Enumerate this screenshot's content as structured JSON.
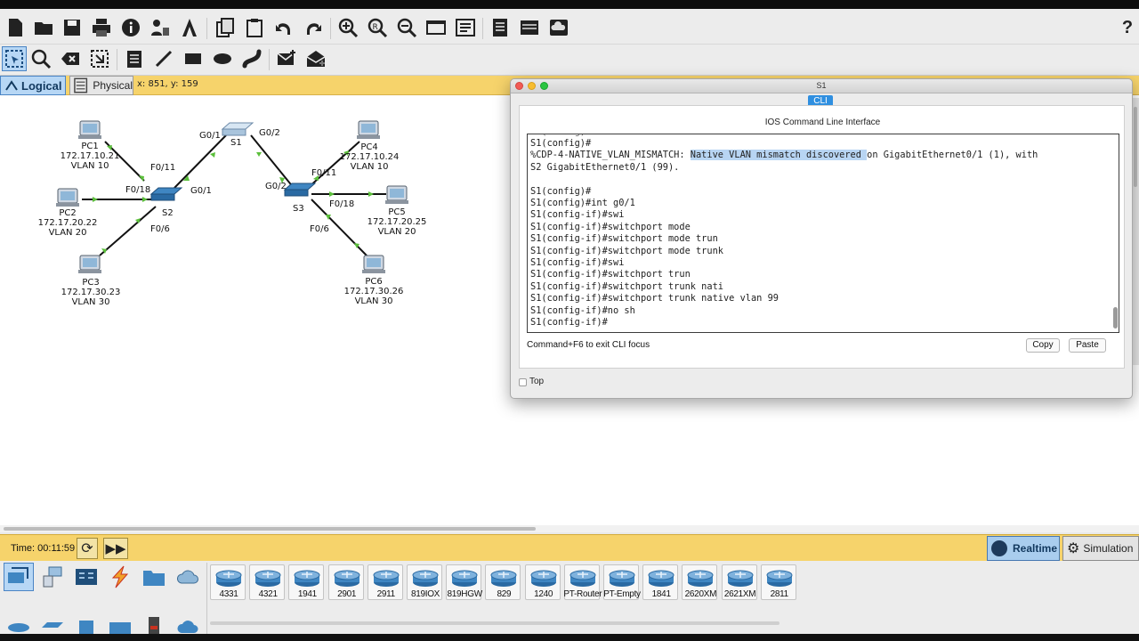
{
  "toolbar": {
    "help_label": "?"
  },
  "mode": {
    "logical_label": "Logical",
    "physical_label": "Physical",
    "coords": "x: 851, y: 159"
  },
  "topology": {
    "devices": {
      "pc1": {
        "name": "PC1",
        "ip": "172.17.10.21",
        "vlan": "VLAN 10"
      },
      "pc2": {
        "name": "PC2",
        "ip": "172.17.20.22",
        "vlan": "VLAN 20"
      },
      "pc3": {
        "name": "PC3",
        "ip": "172.17.30.23",
        "vlan": "VLAN 30"
      },
      "pc4": {
        "name": "PC4",
        "ip": "172.17.10.24",
        "vlan": "VLAN 10"
      },
      "pc5": {
        "name": "PC5",
        "ip": "172.17.20.25",
        "vlan": "VLAN 20"
      },
      "pc6": {
        "name": "PC6",
        "ip": "172.17.30.26",
        "vlan": "VLAN 30"
      },
      "s1": {
        "name": "S1"
      },
      "s2": {
        "name": "S2"
      },
      "s3": {
        "name": "S3"
      }
    },
    "ports": {
      "s2_f011": "F0/11",
      "s2_f018": "F0/18",
      "s2_g01": "G0/1",
      "s2_f06": "F0/6",
      "s1_g01": "G0/1",
      "s1_g02": "G0/2",
      "s3_g02": "G0/2",
      "s3_f011": "F0/11",
      "s3_f018": "F0/18",
      "s3_f06": "F0/6"
    }
  },
  "cli_window": {
    "title": "S1",
    "tab": "CLI",
    "heading": "IOS Command Line Interface",
    "lines": [
      {
        "pre": "S1(config)#",
        "hl": "",
        "post": ""
      },
      {
        "pre": "%CDP-4-NATIVE_VLAN_MISMATCH: ",
        "hl": "Native VLAN mismatch discovered ",
        "post": "on GigabitEthernet0/1 (1), with"
      },
      {
        "pre": "S2 GigabitEthernet0/1 (99).",
        "hl": "",
        "post": ""
      },
      {
        "pre": "",
        "hl": "",
        "post": ""
      },
      {
        "pre": "S1(config)#",
        "hl": "",
        "post": ""
      },
      {
        "pre": "S1(config)#int g0/1",
        "hl": "",
        "post": ""
      },
      {
        "pre": "S1(config-if)#swi",
        "hl": "",
        "post": ""
      },
      {
        "pre": "S1(config-if)#switchport mode",
        "hl": "",
        "post": ""
      },
      {
        "pre": "S1(config-if)#switchport mode trun",
        "hl": "",
        "post": ""
      },
      {
        "pre": "S1(config-if)#switchport mode trunk",
        "hl": "",
        "post": ""
      },
      {
        "pre": "S1(config-if)#swi",
        "hl": "",
        "post": ""
      },
      {
        "pre": "S1(config-if)#switchport trun",
        "hl": "",
        "post": ""
      },
      {
        "pre": "S1(config-if)#switchport trunk nati",
        "hl": "",
        "post": ""
      },
      {
        "pre": "S1(config-if)#switchport trunk native vlan 99",
        "hl": "",
        "post": ""
      },
      {
        "pre": "S1(config-if)#no sh",
        "hl": "",
        "post": ""
      },
      {
        "pre": "S1(config-if)#",
        "hl": "",
        "post": ""
      }
    ],
    "focus_hint": "Command+F6 to exit CLI focus",
    "copy_label": "Copy",
    "paste_label": "Paste",
    "top_label": "Top"
  },
  "timebar": {
    "time": "Time: 00:11:59",
    "realtime_label": "Realtime",
    "simulation_label": "Simulation"
  },
  "palette": {
    "devices": [
      "4331",
      "4321",
      "1941",
      "2901",
      "2911",
      "819IOX",
      "819HGW",
      "829",
      "1240",
      "PT-Router",
      "PT-Empty",
      "1841",
      "2620XM",
      "2621XM",
      "2811"
    ]
  },
  "colors": {
    "accent_yellow": "#f6d36b",
    "selected_blue": "#b7d7f5",
    "link_dot": "#5bbf3b",
    "cli_tab": "#2f8fe0"
  }
}
